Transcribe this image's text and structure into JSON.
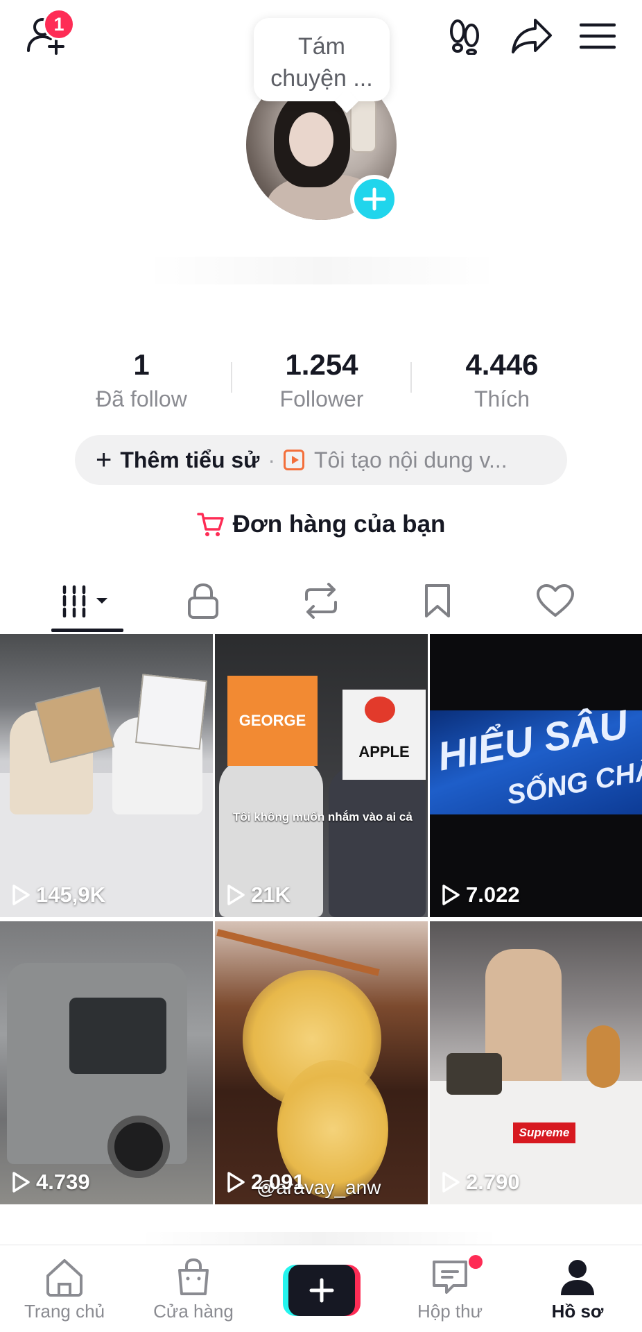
{
  "header": {
    "notification_count": "1",
    "icons": [
      "add-friend-icon",
      "footprint-icon",
      "share-icon",
      "menu-icon"
    ]
  },
  "profile": {
    "note_bubble_line1": "Tám",
    "note_bubble_line2": "chuyện ..."
  },
  "stats": [
    {
      "value": "1",
      "label": "Đã follow"
    },
    {
      "value": "1.254",
      "label": "Follower"
    },
    {
      "value": "4.446",
      "label": "Thích"
    }
  ],
  "bio": {
    "add_bio_label": "Thêm tiểu sử",
    "separator": "·",
    "creator_text": "Tôi tạo nội dung v..."
  },
  "orders": {
    "label": "Đơn hàng của bạn"
  },
  "tabs": [
    "videos-grid",
    "private",
    "repost",
    "saved",
    "liked"
  ],
  "videos": [
    {
      "views": "145,9K"
    },
    {
      "views": "21K",
      "caption": "Tôi không muốn nhắm vào ai cả",
      "bag_left": "GEORGE",
      "bag_right": "APPLE"
    },
    {
      "views": "7.022",
      "banner_line1": "HIỂU SÂU",
      "banner_line2": "SỐNG CHẤT"
    },
    {
      "views": "4.739"
    },
    {
      "views": "2.091",
      "watermark": "@aravay_anw"
    },
    {
      "views": "2.790",
      "brand": "Supreme"
    }
  ],
  "bottom_nav": {
    "home": "Trang chủ",
    "shop": "Cửa hàng",
    "inbox": "Hộp thư",
    "profile": "Hồ sơ"
  },
  "colors": {
    "accent_red": "#fe2c55",
    "accent_cyan": "#20d5ec",
    "text_primary": "#161823",
    "text_secondary": "#8a8b91"
  }
}
